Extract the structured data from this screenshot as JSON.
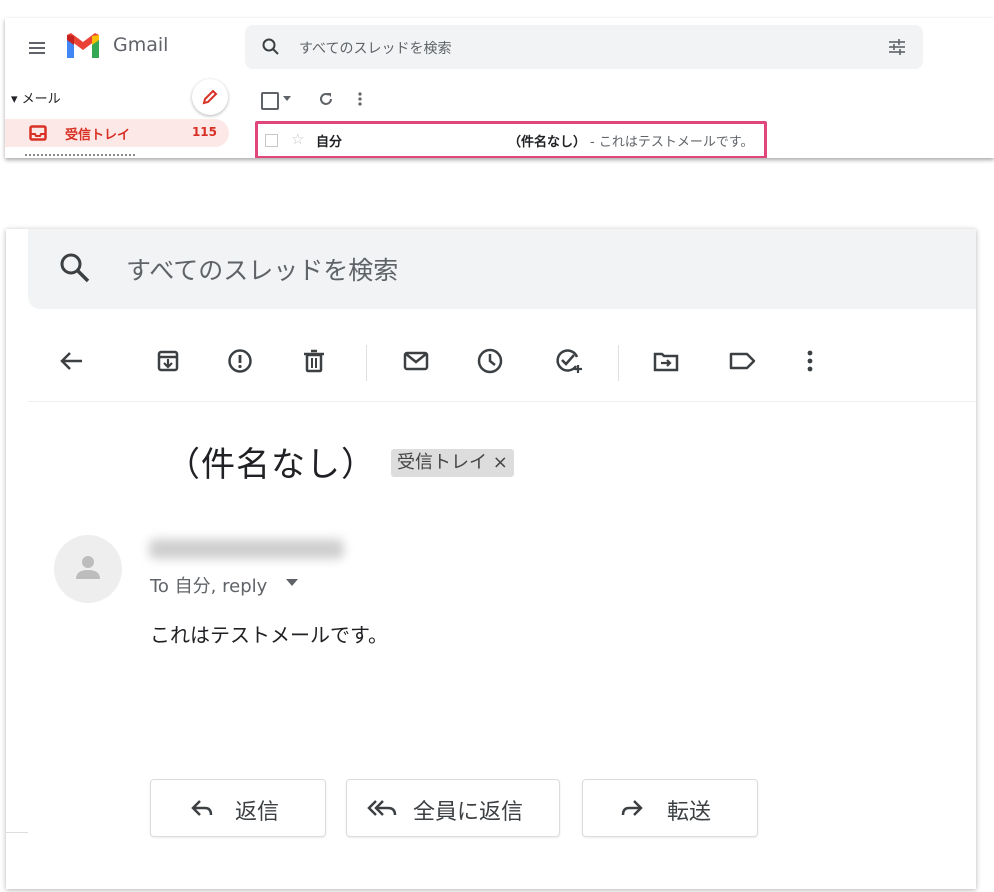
{
  "top": {
    "app_name": "Gmail",
    "search_placeholder": "すべてのスレッドを検索",
    "sidebar": {
      "mail_section": "▾ メール",
      "inbox_label": "受信トレイ",
      "inbox_count": "115"
    },
    "row": {
      "sender": "自分",
      "subject": "（件名なし）",
      "snippet": "- これはテストメールです。"
    }
  },
  "detail": {
    "search_placeholder": "すべてのスレッドを検索",
    "subject": "（件名なし）",
    "label_chip": "受信トレイ ×",
    "to_line": "To 自分, reply",
    "body": "これはテストメールです。",
    "buttons": {
      "reply": "返信",
      "reply_all": "全員に返信",
      "forward": "転送"
    }
  },
  "icons": [
    "menu-icon",
    "gmail-logo",
    "search-icon",
    "tune-icon",
    "pencil-icon",
    "inbox-icon",
    "refresh-icon",
    "more-vert-icon",
    "back-arrow-icon",
    "archive-icon",
    "report-spam-icon",
    "delete-icon",
    "mark-unread-icon",
    "snooze-icon",
    "add-task-icon",
    "move-to-icon",
    "label-icon",
    "person-icon",
    "reply-icon",
    "reply-all-icon",
    "forward-icon"
  ],
  "colors": {
    "accent_red": "#d93025",
    "highlight_border": "#e0457b",
    "search_bg": "#f1f3f4"
  }
}
